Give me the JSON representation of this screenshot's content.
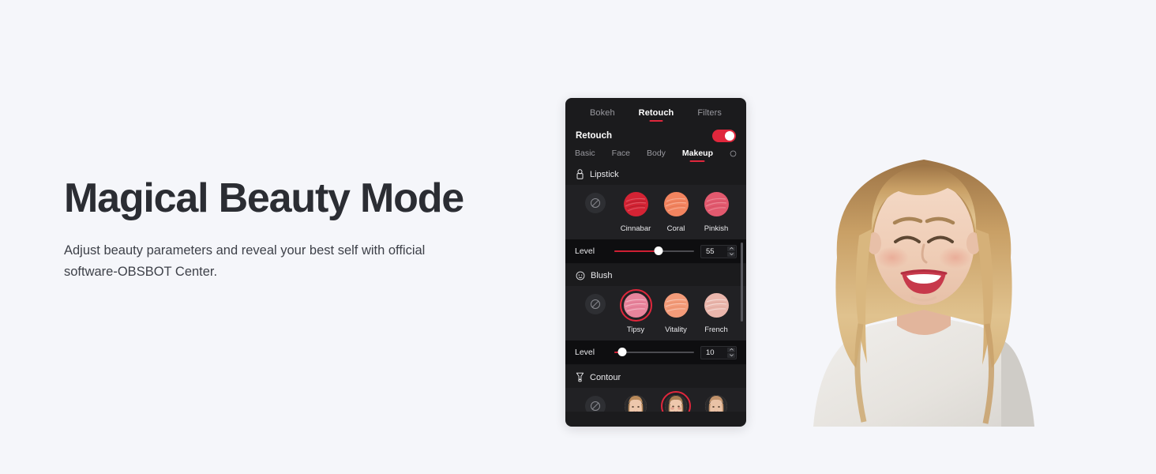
{
  "hero": {
    "headline": "Magical Beauty Mode",
    "subcopy": "Adjust beauty parameters and reveal your best self with official software-OBSBOT Center.",
    "background_color": "#f5f6fa",
    "headline_color": "#2b2d33"
  },
  "photo": {
    "alt": "Smiling blonde woman wearing a light grey t-shirt"
  },
  "panel": {
    "accent_color": "#e0273c",
    "background_color": "#1b1b1d",
    "tabs": [
      {
        "label": "Bokeh",
        "active": false
      },
      {
        "label": "Retouch",
        "active": true
      },
      {
        "label": "Filters",
        "active": false
      }
    ],
    "retouch": {
      "label": "Retouch",
      "toggle_on": true
    },
    "subtabs": [
      {
        "label": "Basic",
        "active": false
      },
      {
        "label": "Face",
        "active": false
      },
      {
        "label": "Body",
        "active": false
      },
      {
        "label": "Makeup",
        "active": true
      }
    ],
    "more_icon": "circle-more-icon",
    "sections": [
      {
        "id": "lipstick",
        "title": "Lipstick",
        "icon": "lipstick-icon",
        "none_option": {
          "label": "",
          "icon": "no-color-icon",
          "selected": false
        },
        "swatches": [
          {
            "name": "Cinnabar",
            "color": "#d42334",
            "selected": false
          },
          {
            "name": "Coral",
            "color": "#f2845f",
            "selected": false
          },
          {
            "name": "Pinkish",
            "color": "#e2596e",
            "selected": false
          }
        ],
        "level": {
          "label": "Level",
          "value": "55",
          "percent": 55
        }
      },
      {
        "id": "blush",
        "title": "Blush",
        "icon": "blush-face-icon",
        "none_option": {
          "label": "",
          "icon": "no-color-icon",
          "selected": false
        },
        "swatches": [
          {
            "name": "Tipsy",
            "color": "#e8849c",
            "selected": true
          },
          {
            "name": "Vitality",
            "color": "#f39b79",
            "selected": false
          },
          {
            "name": "French",
            "color": "#eab6ac",
            "selected": false
          }
        ],
        "level": {
          "label": "Level",
          "value": "10",
          "percent": 10
        }
      },
      {
        "id": "contour",
        "title": "Contour",
        "icon": "contour-brush-icon",
        "none_option": {
          "label": "",
          "icon": "no-color-icon",
          "selected": false
        },
        "faces": [
          {
            "name": "contour-style-1",
            "selected": false
          },
          {
            "name": "contour-style-2",
            "selected": true
          },
          {
            "name": "contour-style-3",
            "selected": false
          }
        ]
      }
    ],
    "scrollbar_visible": true
  }
}
